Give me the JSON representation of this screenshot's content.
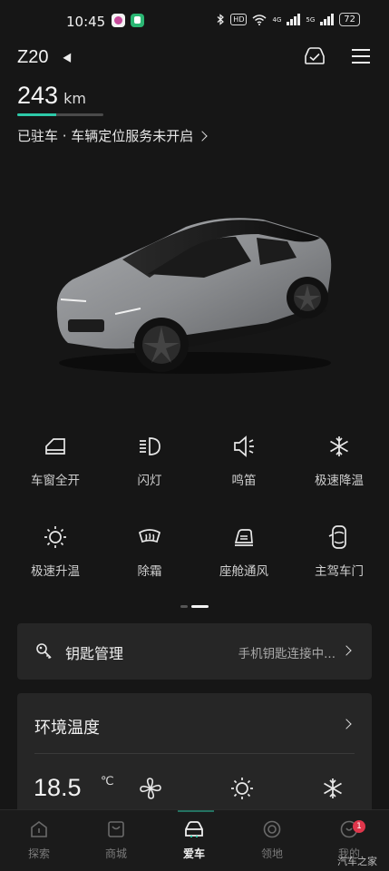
{
  "status_bar": {
    "time": "10:45",
    "hd_label": "HD",
    "signal1_label": "4G",
    "signal2_label": "5G",
    "battery": "72"
  },
  "header": {
    "car_name": "Z20",
    "range_value": "243",
    "range_unit": "km",
    "range_fraction": 0.45,
    "park_status": "已驻车 · 车辆定位服务未开启"
  },
  "controls": [
    {
      "label": "车窗全开",
      "icon": "window-icon"
    },
    {
      "label": "闪灯",
      "icon": "headlight-icon"
    },
    {
      "label": "鸣笛",
      "icon": "horn-icon"
    },
    {
      "label": "极速降温",
      "icon": "snowflake-icon"
    },
    {
      "label": "极速升温",
      "icon": "sun-icon"
    },
    {
      "label": "除霜",
      "icon": "defrost-icon"
    },
    {
      "label": "座舱通风",
      "icon": "seat-vent-icon"
    },
    {
      "label": "主驾车门",
      "icon": "car-door-icon"
    }
  ],
  "pager": {
    "pages": 2,
    "active": 1
  },
  "key_card": {
    "title": "钥匙管理",
    "status": "手机钥匙连接中..."
  },
  "env_card": {
    "title": "环境温度",
    "temperature": "18.5",
    "unit": "℃"
  },
  "nav": [
    {
      "label": "探索",
      "icon": "explore-icon",
      "active": false
    },
    {
      "label": "商城",
      "icon": "shop-icon",
      "active": false
    },
    {
      "label": "爱车",
      "icon": "car-icon",
      "active": true
    },
    {
      "label": "领地",
      "icon": "territory-icon",
      "active": false
    },
    {
      "label": "我的",
      "icon": "profile-icon",
      "active": false
    }
  ],
  "badge_count": "1",
  "watermark": "汽车之家",
  "colors": {
    "background": "#161616",
    "card": "#262626",
    "accent": "#2dc9a8",
    "badge": "#e0364b"
  }
}
